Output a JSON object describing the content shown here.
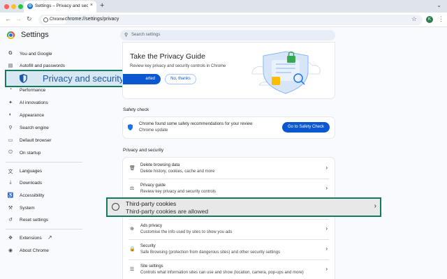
{
  "browser": {
    "tab_title": "Settings – Privacy and securi",
    "tab_close": "×",
    "new_tab": "+",
    "tab_menu": "⌄",
    "site_chip": "Chrome",
    "url": "chrome://settings/privacy",
    "profile_initial": "K",
    "colors": {
      "close": "#ff5f57",
      "minimize": "#febc2e",
      "maximize": "#28c840"
    }
  },
  "settings": {
    "title": "Settings",
    "search_placeholder": "Search settings"
  },
  "sidebar": {
    "items": [
      {
        "label": "You and Google",
        "icon": "google-icon"
      },
      {
        "label": "Autofill and passwords",
        "icon": "autofill-icon"
      },
      {
        "label": "Privacy and security",
        "icon": "shield-icon"
      },
      {
        "label": "Performance",
        "icon": "performance-icon"
      },
      {
        "label": "AI innovations",
        "icon": "sparkle-icon"
      },
      {
        "label": "Appearance",
        "icon": "palette-icon"
      },
      {
        "label": "Search engine",
        "icon": "search-icon"
      },
      {
        "label": "Default browser",
        "icon": "browser-icon"
      },
      {
        "label": "On startup",
        "icon": "power-icon"
      },
      {
        "label": "Languages",
        "icon": "translate-icon"
      },
      {
        "label": "Downloads",
        "icon": "download-icon"
      },
      {
        "label": "Accessibility",
        "icon": "accessibility-icon"
      },
      {
        "label": "System",
        "icon": "wrench-icon"
      },
      {
        "label": "Reset settings",
        "icon": "reset-icon"
      },
      {
        "label": "Extensions",
        "icon": "puzzle-icon"
      },
      {
        "label": "About Chrome",
        "icon": "chrome-icon"
      }
    ]
  },
  "privacy_guide": {
    "title": "Take the Privacy Guide",
    "subtitle": "Review key privacy and security controls in Chrome",
    "start_label": "arted",
    "dismiss_label": "No, thanks"
  },
  "safety_check": {
    "heading": "Safety check",
    "line1": "Chrome found some safety recommendations for your review",
    "line2": "Chrome update",
    "button": "Go to Safety Check"
  },
  "privacy_security": {
    "heading": "Privacy and security",
    "rows": [
      {
        "title": "Delete browsing data",
        "sub": "Delete history, cookies, cache and more",
        "icon": "trash-icon"
      },
      {
        "title": "Privacy guide",
        "sub": "Review key privacy and security controls",
        "icon": "guide-icon"
      },
      {
        "title": "Third-party cookies",
        "sub": "Third-party cookies are allowed",
        "icon": "cookie-icon"
      },
      {
        "title": "Ads privacy",
        "sub": "Customise the info used by sites to show you ads",
        "icon": "ads-icon"
      },
      {
        "title": "Security",
        "sub": "Safe Browsing (protection from dangerous sites) and other security settings",
        "icon": "lock-icon"
      },
      {
        "title": "Site settings",
        "sub": "Controls what information sites can use and show (location, camera, pop-ups and more)",
        "icon": "sliders-icon"
      }
    ]
  },
  "colors": {
    "accent": "#0b57d0",
    "highlight_border": "#127a5f",
    "highlight_nav_bg": "#d7e8f3"
  }
}
